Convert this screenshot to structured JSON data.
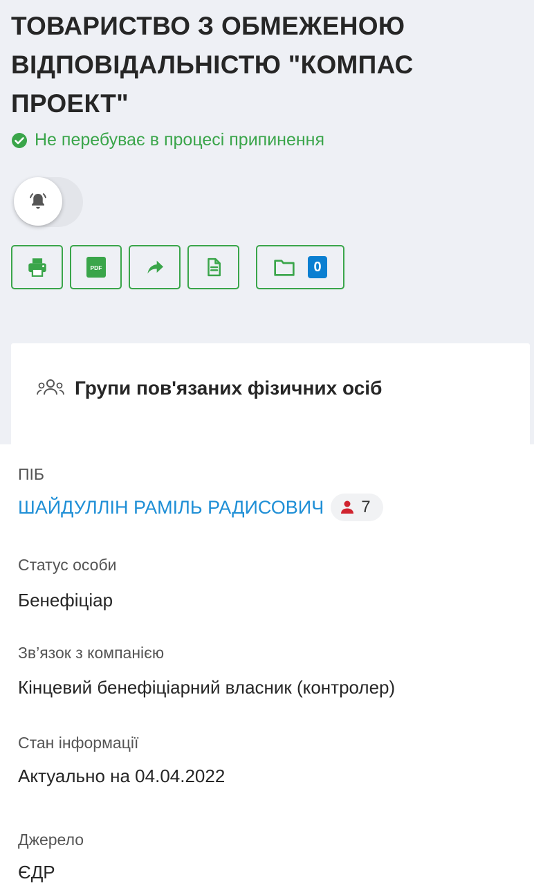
{
  "company": {
    "title": "ТОВАРИСТВО З ОБМЕЖЕНОЮ ВІДПОВІДАЛЬНІСТЮ \"КОМПАС ПРОЕКТ\"",
    "status": "Не перебуває в процесі припинення"
  },
  "toggle": {
    "icon": "bell-icon",
    "state": "off"
  },
  "actions": {
    "print_icon": "printer-icon",
    "pdf_label": "PDF",
    "share_icon": "share-arrow-icon",
    "doc_icon": "document-icon",
    "folder_icon": "folder-icon",
    "folder_count": "0"
  },
  "group": {
    "title": "Групи пов'язаних фізичних осіб",
    "icon": "people-group-icon"
  },
  "person": {
    "name_label": "ПІБ",
    "name": "ШАЙДУЛЛІН РАМІЛЬ РАДИСОВИЧ",
    "related_count": "7",
    "status_label": "Статус особи",
    "status": "Бенефіціар",
    "relation_label": "Зв’язок з компанією",
    "relation": "Кінцевий бенефіціарний власник (контролер)",
    "info_state_label": "Стан інформації",
    "info_state": "Актуально на 04.04.2022",
    "source_label": "Джерело",
    "source": "ЄДР"
  },
  "colors": {
    "accent_green": "#3aa54a",
    "link_blue": "#1f8fd6",
    "badge_blue": "#0b7fd1",
    "person_icon_red": "#d0242f",
    "header_bg": "#eef0f5"
  }
}
